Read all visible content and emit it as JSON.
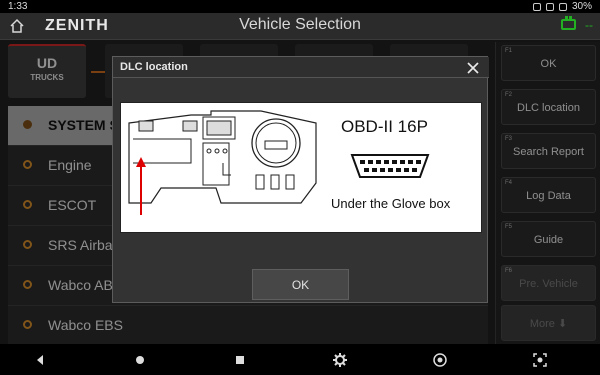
{
  "status": {
    "time": "1:33",
    "battery": "30%"
  },
  "app": {
    "logo": "ZENITH",
    "title": "Vehicle Selection",
    "indicator": "--"
  },
  "tabs": {
    "active_line1": "UD",
    "active_line2": "TRUCKS"
  },
  "list": {
    "items": [
      {
        "label": "SYSTEM S"
      },
      {
        "label": "Engine"
      },
      {
        "label": "ESCOT"
      },
      {
        "label": "SRS Airba"
      },
      {
        "label": "Wabco AB"
      },
      {
        "label": "Wabco EBS"
      }
    ]
  },
  "sidebar": {
    "buttons": [
      {
        "key": "F1",
        "label": "OK"
      },
      {
        "key": "F2",
        "label": "DLC location"
      },
      {
        "key": "F3",
        "label": "Search Report"
      },
      {
        "key": "F4",
        "label": "Log Data"
      },
      {
        "key": "F5",
        "label": "Guide"
      },
      {
        "key": "F6",
        "label": "Pre. Vehicle"
      },
      {
        "key": "",
        "label": "More ⬇"
      }
    ]
  },
  "dialog": {
    "title": "DLC location",
    "image_title": "OBD-II 16P",
    "image_caption": "Under the Glove box",
    "ok_label": "OK"
  },
  "colors": {
    "accent_orange": "#c7681c",
    "accent_red": "#c62828",
    "battery_green": "#23b023"
  },
  "icons": [
    "home-icon",
    "battery-icon",
    "close-icon",
    "back-icon",
    "home-nav-icon",
    "recents-icon",
    "settings-icon",
    "browser-icon",
    "screenshot-icon"
  ]
}
